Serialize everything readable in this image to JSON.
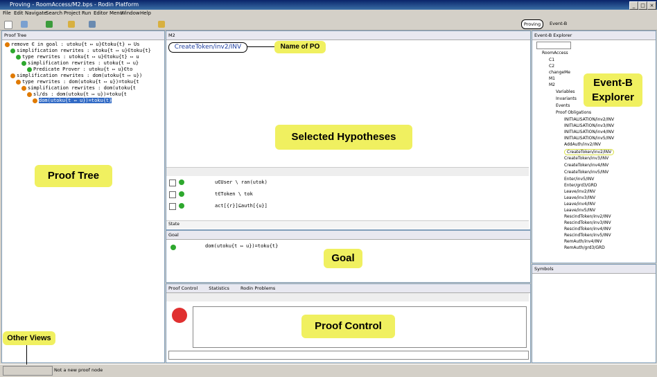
{
  "window": {
    "title": "Proving - RoomAccess/M2.bps - Rodin Platform"
  },
  "menu": [
    "File",
    "Edit",
    "Navigate",
    "Search",
    "Project",
    "Run",
    "Editor Menu",
    "Window",
    "Help"
  ],
  "perspectives": {
    "active": "Proving",
    "other": "Event-B"
  },
  "proof_tree": {
    "tab": "Proof Tree",
    "nodes": [
      "remove ∈ in goal : utoku{t ↦ u}∈toku{t} ↦ Us",
      "simplification rewrites : utoku{t ↦ u}∈toku{t}",
      "type rewrites : utoku{t ↦ u}∈toku{t} ↦ u",
      "simplification rewrites : utoku{t ↦ u}",
      "Predicate Prover : utoku{t ↦ u}∈to",
      "simplification rewrites : dom(utoku{t ↦ u})",
      "type rewrites : dom(utoku{t ↦ u})=toku{t",
      "simplification rewrites : dom(utoku{t",
      "sl/ds : dom(utoku{t ↦ u})=toku{t",
      "dom(utoku{t ↦ u})=toku{t}"
    ]
  },
  "editor": {
    "tab": "M2",
    "po_name": "CreateToken/inv2/INV"
  },
  "hypotheses": {
    "items": [
      "u∈User \\ ran(utok)",
      "t∈Token \\ tok",
      "act[{r}]⊆auth[{u}]"
    ],
    "state_label": "State"
  },
  "goal": {
    "tab": "Goal",
    "text": "dom(utoku{t ↦ u})=toku{t}"
  },
  "proof_control": {
    "tabs": [
      "Proof Control",
      "Statistics",
      "Rodin Problems"
    ]
  },
  "explorer": {
    "tab": "Event-B Explorer",
    "root": "RoomAccess",
    "machines": [
      "C1",
      "C2",
      "changeMe",
      "M1",
      "M2"
    ],
    "m2_children": [
      "Variables",
      "Invariants",
      "Events",
      "Proof Obligations"
    ],
    "pos": [
      "INITIALISATION/inv2/INV",
      "INITIALISATION/inv3/INV",
      "INITIALISATION/inv4/INV",
      "INITIALISATION/inv5/INV",
      "AddAuth/inv2/INV",
      "CreateToken/inv2/INV",
      "CreateToken/inv3/INV",
      "CreateToken/inv4/INV",
      "CreateToken/inv5/INV",
      "Enter/inv5/INV",
      "Enter/grd3/GRD",
      "Leave/inv2/INV",
      "Leave/inv3/INV",
      "Leave/inv4/INV",
      "Leave/inv5/INV",
      "RescindToken/inv2/INV",
      "RescindToken/inv3/INV",
      "RescindToken/inv4/INV",
      "RescindToken/inv5/INV",
      "RemAuth/inv4/INV",
      "RemAuth/grd3/GRD"
    ]
  },
  "symbols": {
    "tab": "Symbols"
  },
  "status": {
    "text": "Not a new proof node"
  },
  "annotations": {
    "po": "Name of PO",
    "explorer": "Event-B Explorer",
    "hyp": "Selected Hypotheses",
    "tree": "Proof Tree",
    "goal": "Goal",
    "control": "Proof Control",
    "views": "Other Views"
  }
}
